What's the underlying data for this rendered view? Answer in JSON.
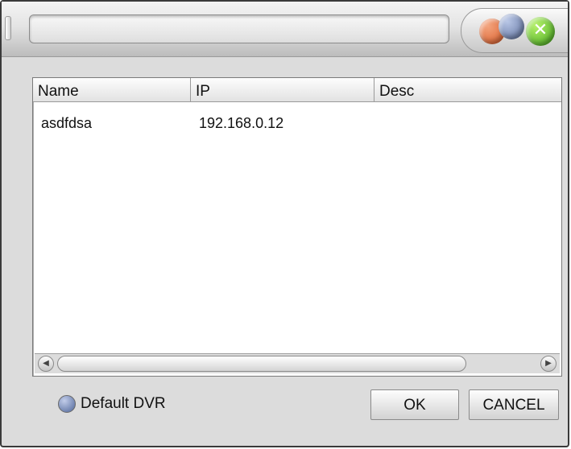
{
  "window": {
    "title": "",
    "controls": [
      "minimize-icon",
      "maximize-icon",
      "close-icon"
    ],
    "close_glyph": "✕"
  },
  "list": {
    "columns": [
      "Name",
      "IP",
      "Desc"
    ],
    "rows": [
      {
        "name": "asdfdsa",
        "ip": "192.168.0.12",
        "desc": ""
      }
    ]
  },
  "scrollbar": {
    "left_glyph": "◀",
    "right_glyph": "▶"
  },
  "footer": {
    "default_dvr_label": "Default DVR",
    "ok_label": "OK",
    "cancel_label": "CANCEL"
  },
  "colors": {
    "window_bg": "#dcdcdc",
    "close_green": "#3fa51a",
    "radio_blue": "#4f6699"
  }
}
